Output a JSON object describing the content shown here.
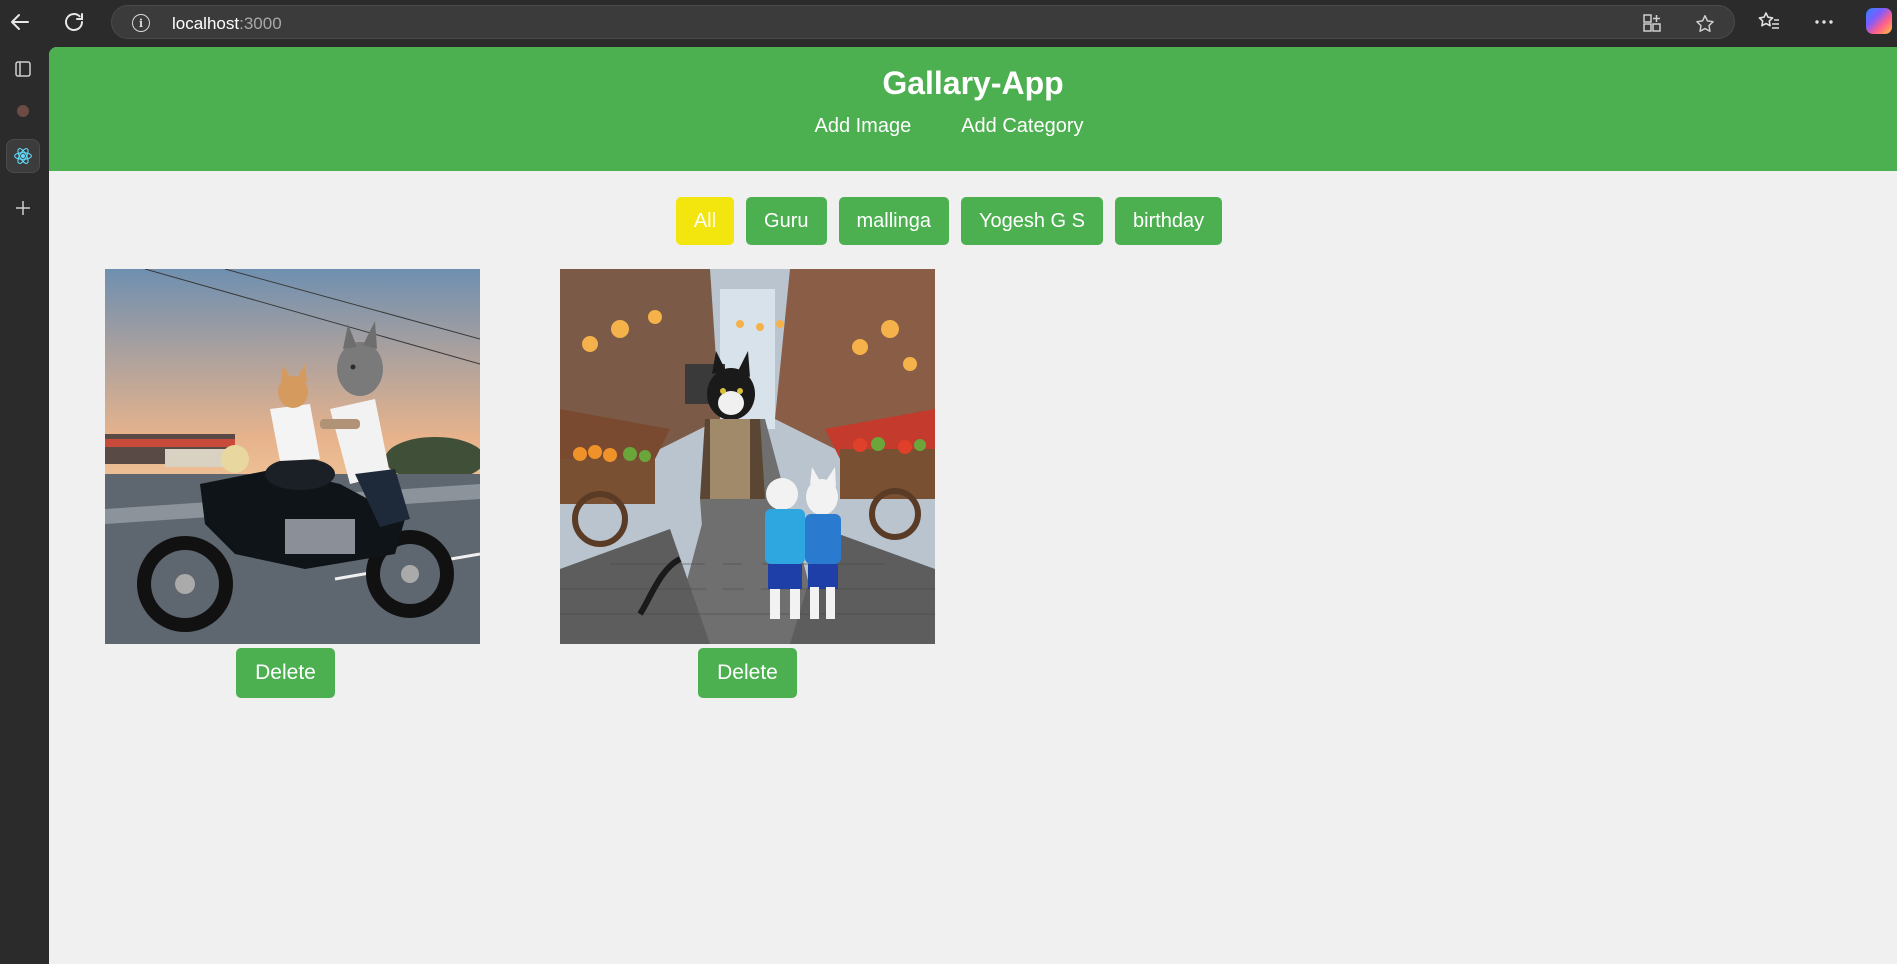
{
  "browser": {
    "url_host": "localhost",
    "url_port": ":3000"
  },
  "app": {
    "title": "Gallary-App",
    "nav": {
      "add_image": "Add Image",
      "add_category": "Add Category"
    }
  },
  "filters": [
    {
      "label": "All",
      "active": true
    },
    {
      "label": "Guru",
      "active": false
    },
    {
      "label": "mallinga",
      "active": false
    },
    {
      "label": "Yogesh G S",
      "active": false
    },
    {
      "label": "birthday",
      "active": false
    }
  ],
  "gallery": {
    "items": [
      {
        "delete_label": "Delete"
      },
      {
        "delete_label": "Delete"
      }
    ]
  },
  "colors": {
    "primary": "#4caf50",
    "active_filter": "#f2e60e",
    "page_bg": "#f0f0f0"
  }
}
